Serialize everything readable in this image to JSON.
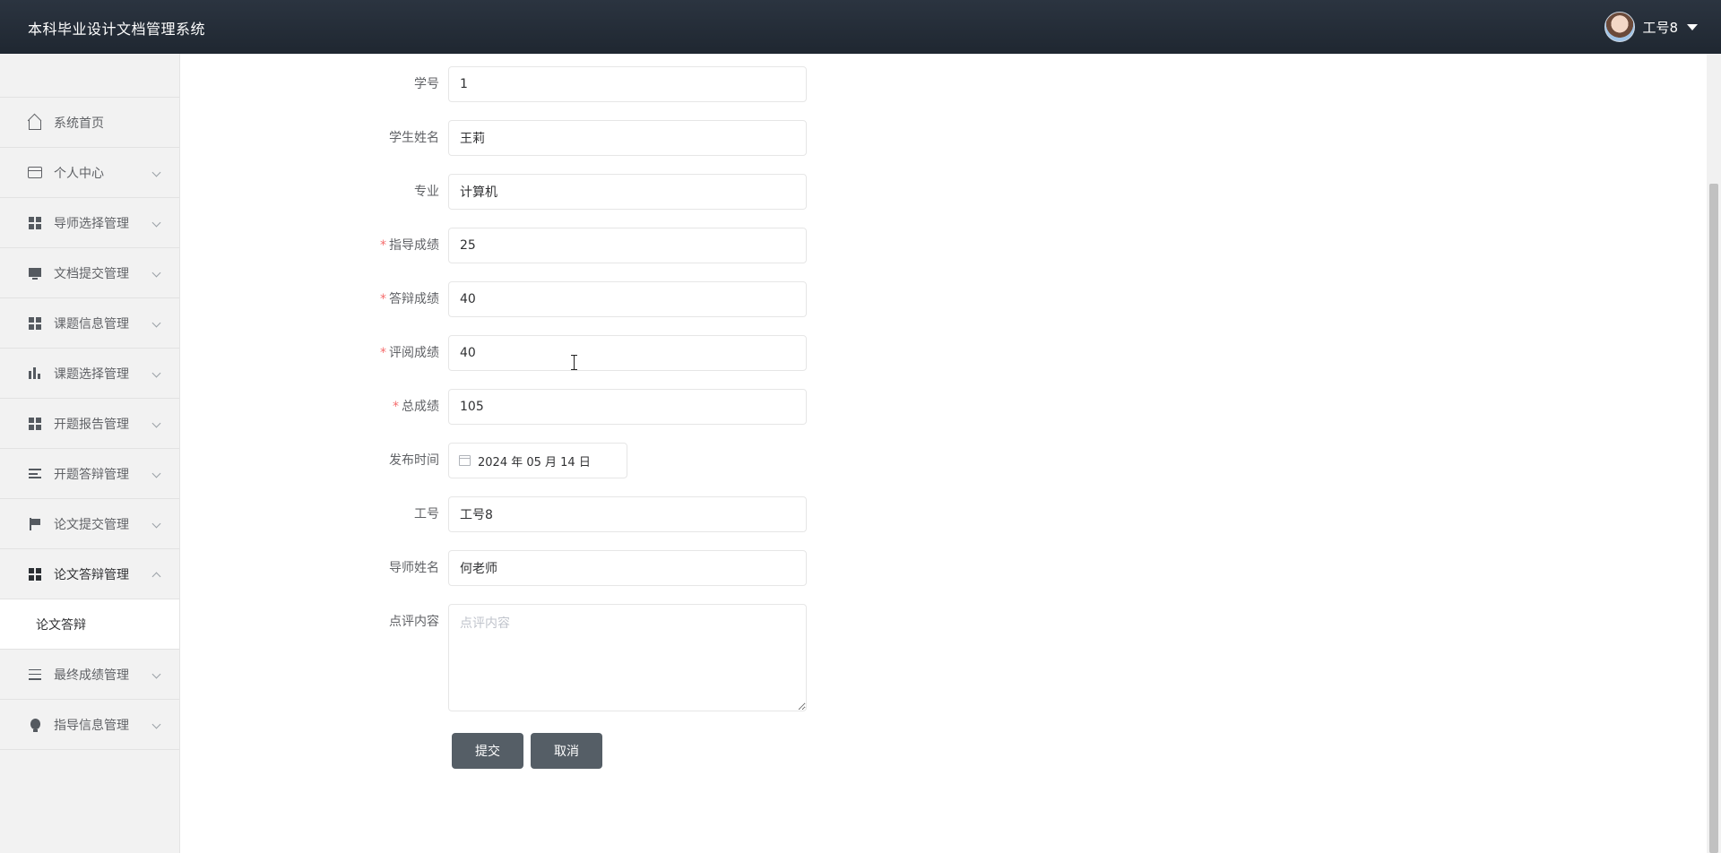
{
  "header": {
    "app_title": "本科毕业设计文档管理系统",
    "user_name": "工号8"
  },
  "sidebar": {
    "items": [
      {
        "label": "系统首页",
        "icon": "home-icon"
      },
      {
        "label": "个人中心",
        "icon": "id-card-icon"
      },
      {
        "label": "导师选择管理",
        "icon": "grid-icon"
      },
      {
        "label": "文档提交管理",
        "icon": "monitor-icon"
      },
      {
        "label": "课题信息管理",
        "icon": "grid-icon"
      },
      {
        "label": "课题选择管理",
        "icon": "bar-chart-icon"
      },
      {
        "label": "开题报告管理",
        "icon": "grid-icon"
      },
      {
        "label": "开题答辩管理",
        "icon": "list-icon"
      },
      {
        "label": "论文提交管理",
        "icon": "flag-icon"
      },
      {
        "label": "论文答辩管理",
        "icon": "grid-icon",
        "expanded": true
      },
      {
        "label": "最终成绩管理",
        "icon": "sliders-icon"
      },
      {
        "label": "指导信息管理",
        "icon": "bulb-icon"
      }
    ],
    "submenu": {
      "label": "论文答辩"
    }
  },
  "form": {
    "student_id": {
      "label": "学号",
      "value": "1"
    },
    "student_name": {
      "label": "学生姓名",
      "value": "王莉"
    },
    "major": {
      "label": "专业",
      "value": "计算机"
    },
    "guidance_score": {
      "label": "指导成绩",
      "value": "25",
      "required": true
    },
    "defense_score": {
      "label": "答辩成绩",
      "value": "40",
      "required": true
    },
    "review_score": {
      "label": "评阅成绩",
      "value": "40",
      "required": true
    },
    "total_score": {
      "label": "总成绩",
      "value": "105",
      "required": true
    },
    "publish_time": {
      "label": "发布时间",
      "value": "2024 年 05 月 14 日"
    },
    "staff_id": {
      "label": "工号",
      "value": "工号8"
    },
    "tutor_name": {
      "label": "导师姓名",
      "value": "何老师"
    },
    "comment": {
      "label": "点评内容",
      "placeholder": "点评内容",
      "value": ""
    },
    "submit_label": "提交",
    "cancel_label": "取消",
    "required_mark": "*"
  },
  "colors": {
    "header_bg": "#242d38",
    "button_bg": "#555e66",
    "required": "#f56c6c",
    "sidebar_bg": "#f2f2f2"
  }
}
